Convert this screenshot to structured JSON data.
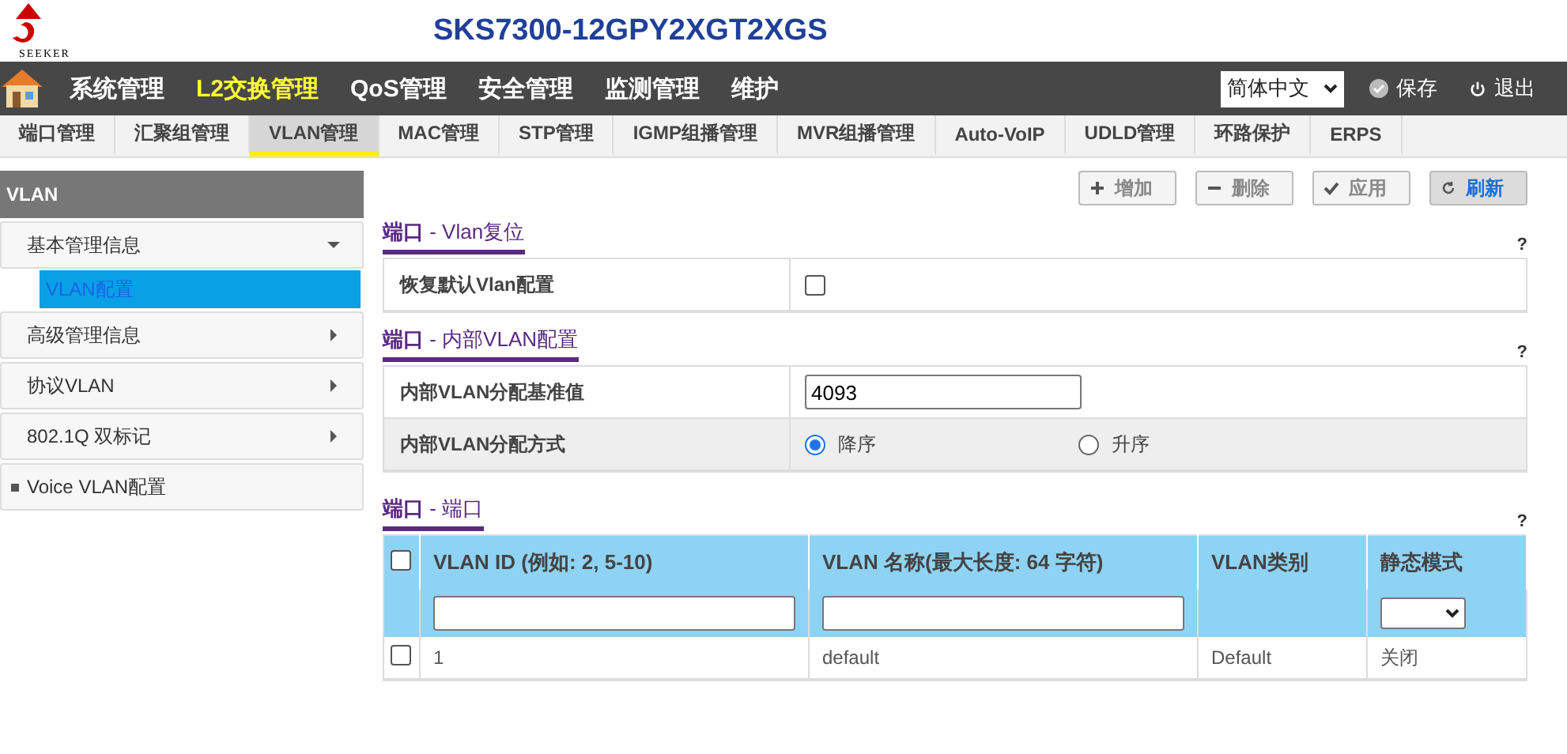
{
  "header": {
    "logo_text": "SEEKER",
    "title": "SKS7300-12GPY2XGT2XGS"
  },
  "main_menu": [
    {
      "label": "系统管理",
      "selected": false
    },
    {
      "label": "L2交换管理",
      "selected": true
    },
    {
      "label": "QoS管理",
      "selected": false
    },
    {
      "label": "安全管理",
      "selected": false
    },
    {
      "label": "监测管理",
      "selected": false
    },
    {
      "label": "维护",
      "selected": false
    }
  ],
  "language": "简体中文",
  "save": "保存",
  "logout": "退出",
  "tabs": [
    {
      "label": "端口管理",
      "selected": false
    },
    {
      "label": "汇聚组管理",
      "selected": false
    },
    {
      "label": "VLAN管理",
      "selected": true
    },
    {
      "label": "MAC管理",
      "selected": false
    },
    {
      "label": "STP管理",
      "selected": false
    },
    {
      "label": "IGMP组播管理",
      "selected": false
    },
    {
      "label": "MVR组播管理",
      "selected": false
    },
    {
      "label": "Auto-VoIP",
      "selected": false
    },
    {
      "label": "UDLD管理",
      "selected": false
    },
    {
      "label": "环路保护",
      "selected": false
    },
    {
      "label": "ERPS",
      "selected": false
    }
  ],
  "sidebar": {
    "title": "VLAN",
    "items": [
      {
        "label": "基本管理信息",
        "kind": "group",
        "expanded": true,
        "children": [
          {
            "label": "VLAN配置",
            "selected": true
          }
        ]
      },
      {
        "label": "高级管理信息",
        "kind": "group",
        "expanded": false
      },
      {
        "label": "协议VLAN",
        "kind": "group",
        "expanded": false
      },
      {
        "label": "802.1Q 双标记",
        "kind": "group",
        "expanded": false
      },
      {
        "label": "Voice VLAN配置",
        "kind": "leaf"
      }
    ]
  },
  "toolbar": [
    {
      "label": "增加",
      "disabled": true
    },
    {
      "label": "删除",
      "disabled": true
    },
    {
      "label": "应用",
      "disabled": true
    },
    {
      "label": "刷新",
      "disabled": false
    }
  ],
  "sections": [
    {
      "prefix": "端口",
      "title": " - Vlan复位",
      "help": "?",
      "rows": [
        {
          "label": "恢复默认Vlan配置",
          "kind": "checkbox",
          "checked": false
        }
      ]
    },
    {
      "prefix": "端口",
      "title": " - 内部VLAN配置",
      "help": "?",
      "rows": [
        {
          "label": "内部VLAN分配基准值",
          "kind": "input",
          "value": "4093"
        },
        {
          "label": "内部VLAN分配方式",
          "kind": "radio",
          "options": [
            {
              "label": "降序",
              "selected": true
            },
            {
              "label": "升序",
              "selected": false
            }
          ]
        }
      ]
    }
  ],
  "table_section": {
    "prefix": "端口",
    "title": " - 端口",
    "help": "?",
    "columns": [
      "VLAN ID (例如: 2, 5-10)",
      "VLAN 名称(最大长度: 64 字符)",
      "VLAN类别",
      "静态模式"
    ],
    "header_checked": false,
    "rows": [
      {
        "checked": false,
        "cells": [
          "1",
          "default",
          "Default",
          "关闭"
        ]
      }
    ]
  }
}
